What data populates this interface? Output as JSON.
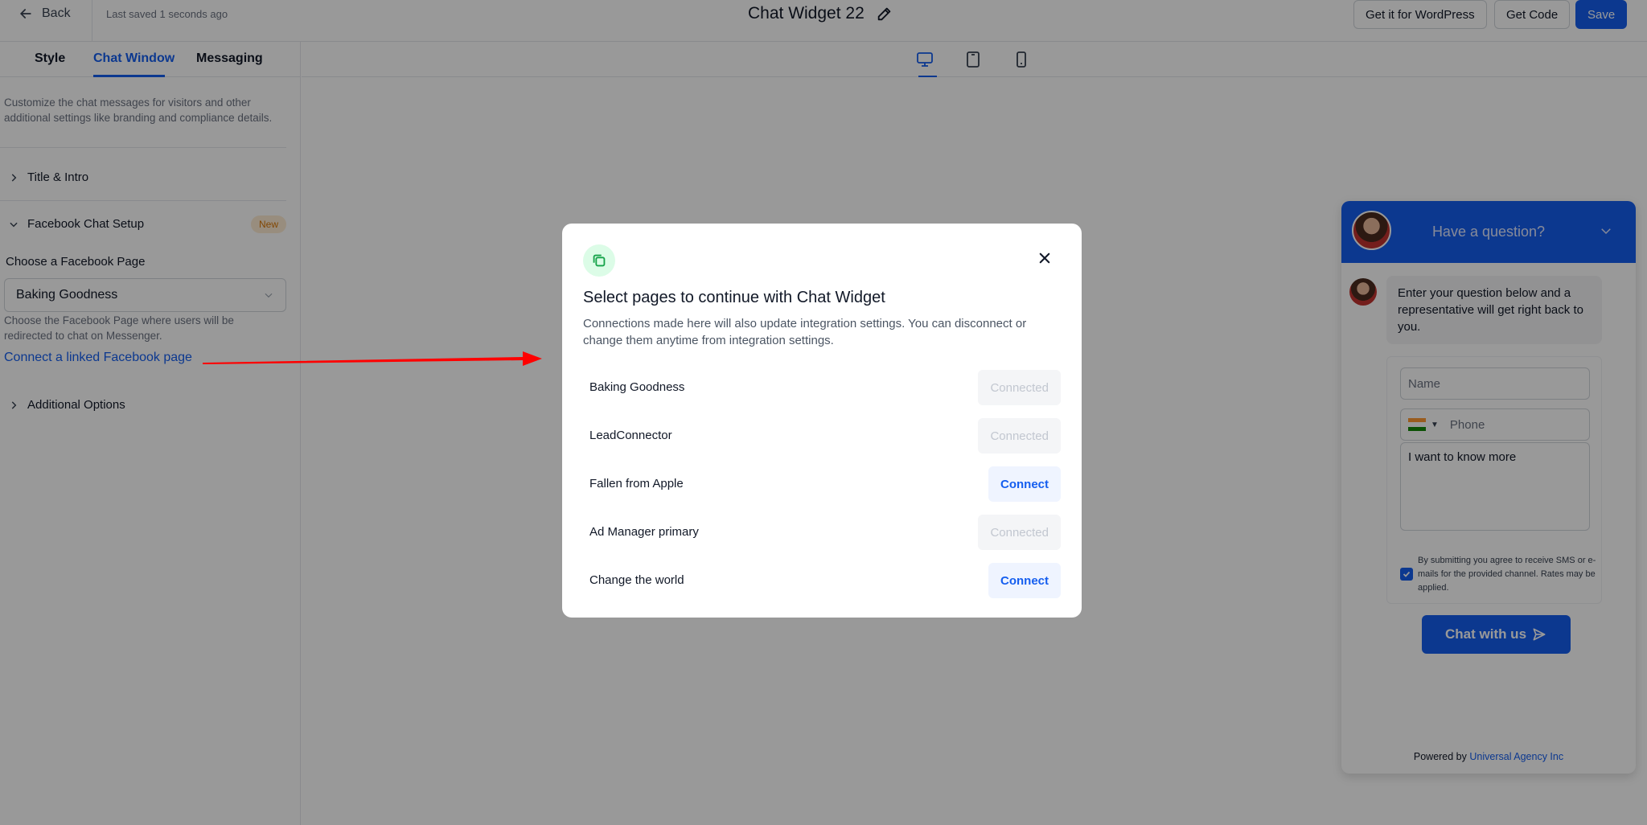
{
  "header": {
    "back_label": "Back",
    "saved_text": "Last saved 1 seconds ago",
    "title": "Chat Widget 22",
    "wordpress_label": "Get it for WordPress",
    "get_code_label": "Get Code",
    "save_label": "Save"
  },
  "left_panel": {
    "tabs": [
      {
        "label": "Style"
      },
      {
        "label": "Chat Window"
      },
      {
        "label": "Messaging"
      }
    ],
    "active_tab": "Chat Window",
    "description": "Customize the chat messages for visitors and other additional settings like branding and compliance details.",
    "sections": {
      "title_intro": "Title & Intro",
      "facebook": "Facebook Chat Setup",
      "facebook_badge": "New",
      "additional": "Additional Options"
    },
    "page_label": "Choose a Facebook Page",
    "page_selected": "Baking Goodness",
    "page_helper": "Choose the Facebook Page where users will be redirected to chat on Messenger.",
    "connect_link": "Connect a linked Facebook page"
  },
  "devices": [
    "desktop-icon",
    "tablet-icon",
    "mobile-icon"
  ],
  "widget": {
    "header_title": "Have a question?",
    "intro_message": "Enter your question below and a representative will get right back to you.",
    "name_placeholder": "Name",
    "phone_placeholder": "Phone",
    "message_value": "I want to know more",
    "consent_text": "By submitting you agree to receive SMS or e-mails for the provided channel. Rates may be applied.",
    "button_label": "Chat with us",
    "powered_prefix": "Powered by",
    "powered_link": "Universal Agency Inc"
  },
  "modal": {
    "title": "Select pages to continue with Chat Widget",
    "description": "Connections made here will also update integration settings. You can disconnect or change them anytime from integration settings.",
    "pages": [
      {
        "name": "Baking Goodness",
        "action": "Connected",
        "connected": true
      },
      {
        "name": "LeadConnector",
        "action": "Connected",
        "connected": true
      },
      {
        "name": "Fallen from Apple",
        "action": "Connect",
        "connected": false
      },
      {
        "name": "Ad Manager primary",
        "action": "Connected",
        "connected": true
      },
      {
        "name": "Change the world",
        "action": "Connect",
        "connected": false
      }
    ]
  },
  "colors": {
    "accent": "#155eef",
    "overlay": "rgba(0,0,0,0.4)",
    "annotation_arrow": "#ff0000",
    "badge_bg": "#fdebd3",
    "badge_text": "#d97706"
  }
}
